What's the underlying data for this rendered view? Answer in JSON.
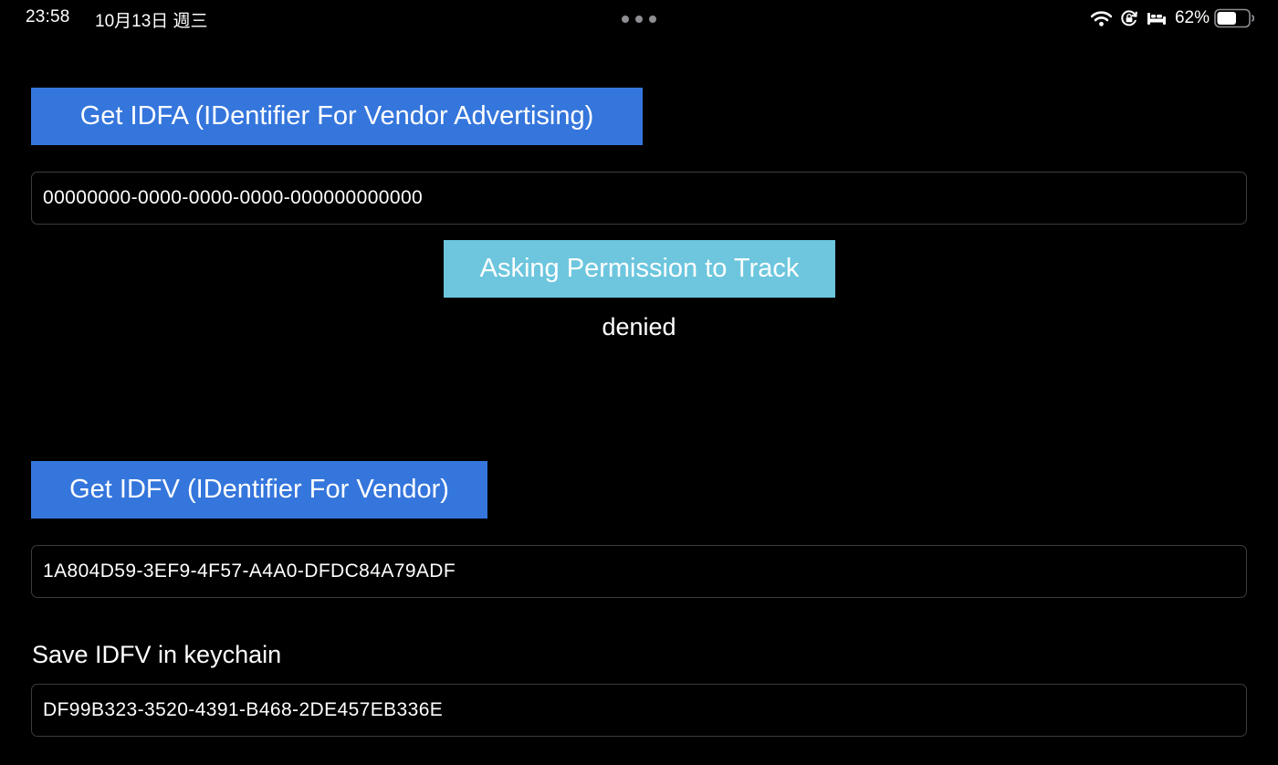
{
  "status_bar": {
    "time": "23:58",
    "date": "10月13日 週三",
    "battery_percent": "62%",
    "battery_level": 0.62,
    "icons": [
      "wifi-icon",
      "orientation-lock-icon",
      "sleep-bed-icon",
      "battery-icon"
    ]
  },
  "idfa": {
    "button_label": "Get IDFA (IDentifier For Vendor Advertising)",
    "value": "00000000-0000-0000-0000-000000000000"
  },
  "tracking": {
    "button_label": "Asking Permission to Track",
    "status": "denied"
  },
  "idfv": {
    "button_label": "Get IDFV (IDentifier For Vendor)",
    "value": "1A804D59-3EF9-4F57-A4A0-DFDC84A79ADF"
  },
  "keychain": {
    "label": "Save IDFV in keychain",
    "value": "DF99B323-3520-4391-B468-2DE457EB336E"
  },
  "colors": {
    "background": "#000000",
    "primary_button": "#3576dc",
    "info_button": "#6dc6de",
    "field_border": "#3c3c40",
    "text": "#ffffff"
  }
}
